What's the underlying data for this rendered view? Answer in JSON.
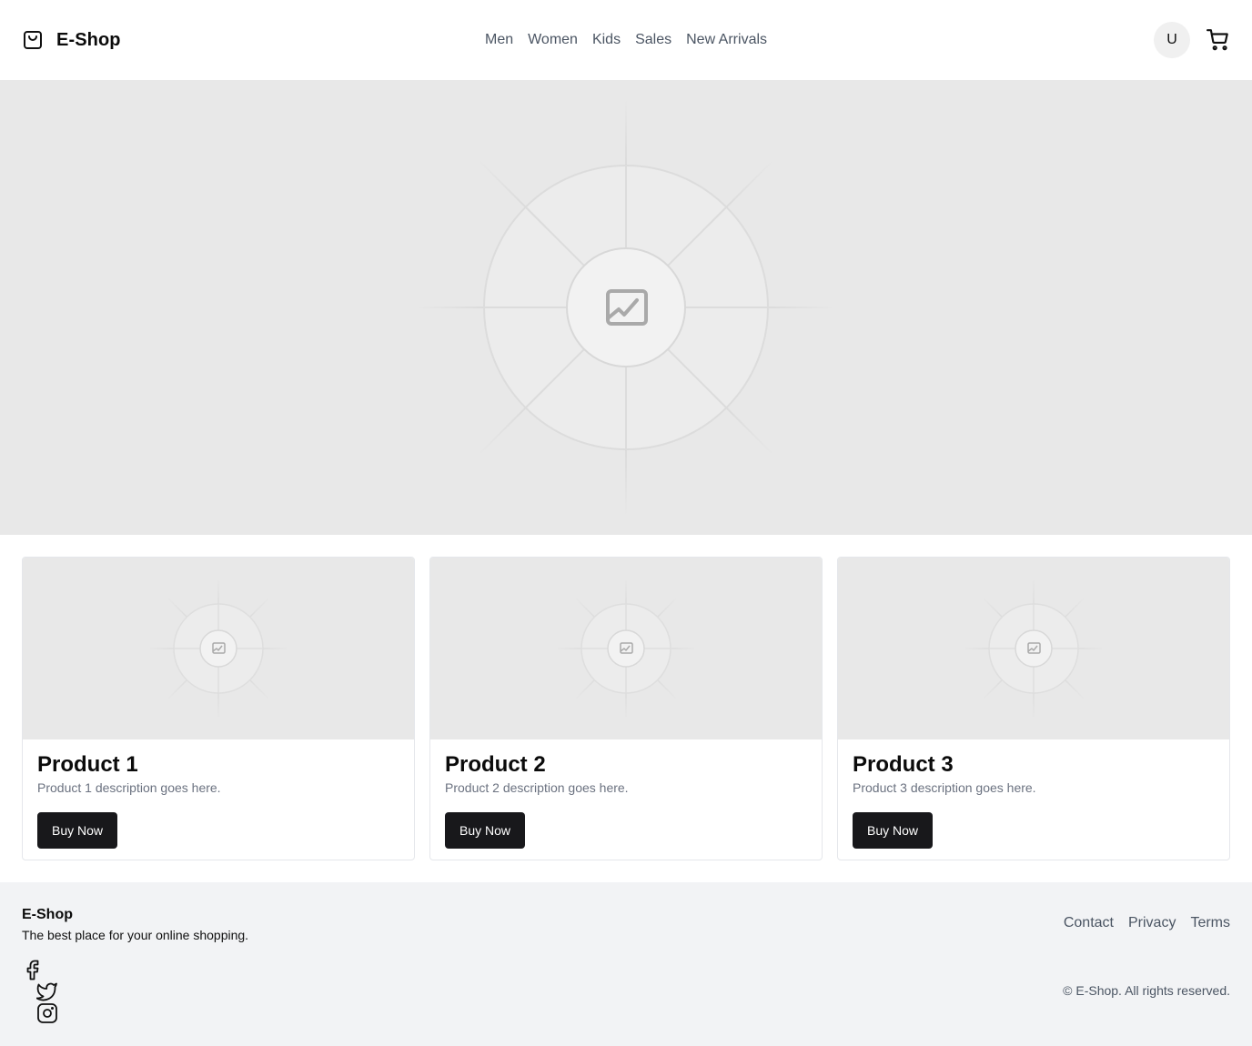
{
  "header": {
    "brand": "E-Shop",
    "nav": [
      "Men",
      "Women",
      "Kids",
      "Sales",
      "New Arrivals"
    ],
    "avatar_initial": "U"
  },
  "hero": {
    "image": "image-placeholder-icon"
  },
  "products": [
    {
      "title": "Product 1",
      "description": "Product 1 description goes here.",
      "button": "Buy Now"
    },
    {
      "title": "Product 2",
      "description": "Product 2 description goes here.",
      "button": "Buy Now"
    },
    {
      "title": "Product 3",
      "description": "Product 3 description goes here.",
      "button": "Buy Now"
    }
  ],
  "footer": {
    "brand": "E-Shop",
    "tagline": "The best place for your online shopping.",
    "social": [
      "facebook-icon",
      "twitter-icon",
      "instagram-icon"
    ],
    "links": [
      "Contact",
      "Privacy",
      "Terms"
    ],
    "copyright": "© E-Shop. All rights reserved."
  },
  "colors": {
    "primary_button": "#18181b",
    "placeholder_bg": "#e8e8e8",
    "footer_bg": "#f2f3f5",
    "muted_text": "#6b7280"
  }
}
